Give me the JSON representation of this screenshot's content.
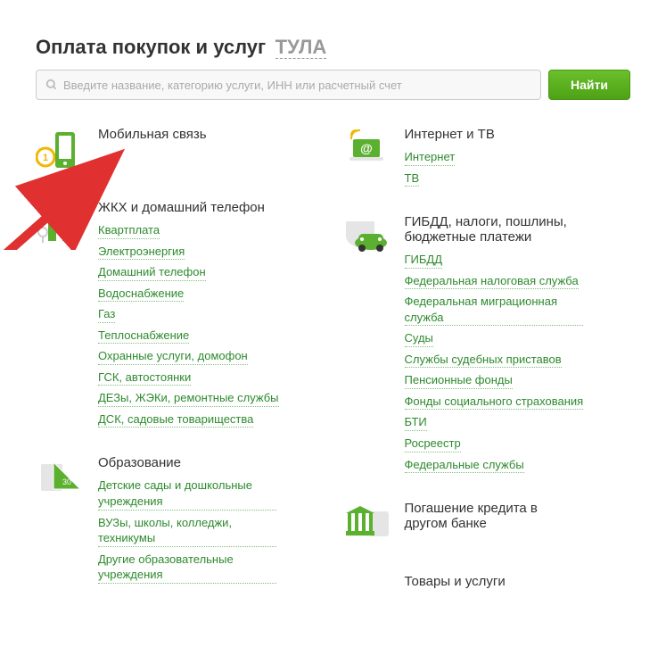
{
  "header": {
    "title": "Оплата покупок и услуг",
    "region": "ТУЛА"
  },
  "search": {
    "placeholder": "Введите название, категорию услуги, ИНН или расчетный счет",
    "button": "Найти"
  },
  "left": [
    {
      "title": "Мобильная связь",
      "links": []
    },
    {
      "title": "ЖКХ и домашний телефон",
      "links": [
        "Квартплата",
        "Электроэнергия",
        "Домашний телефон",
        "Водоснабжение",
        "Газ",
        "Теплоснабжение",
        "Охранные услуги, домофон",
        "ГСК, автостоянки",
        "ДЕЗы, ЖЭКи, ремонтные службы",
        "ДСК, садовые товарищества"
      ]
    },
    {
      "title": "Образование",
      "links": [
        "Детские сады и дошкольные учреждения",
        "ВУЗы, школы, колледжи, техникумы",
        "Другие образовательные учреждения"
      ]
    }
  ],
  "right": [
    {
      "title": "Интернет и ТВ",
      "links": [
        "Интернет",
        "ТВ"
      ]
    },
    {
      "title": "ГИБДД, налоги, пошлины, бюджетные платежи",
      "links": [
        "ГИБДД",
        "Федеральная налоговая служба",
        "Федеральная миграционная служба",
        "Суды",
        "Службы судебных приставов",
        "Пенсионные фонды",
        "Фонды социального страхования",
        "БТИ",
        "Росреестр",
        "Федеральные службы"
      ]
    },
    {
      "title": "Погашение кредита в другом банке",
      "links": []
    },
    {
      "title": "Товары и услуги",
      "links": []
    }
  ]
}
